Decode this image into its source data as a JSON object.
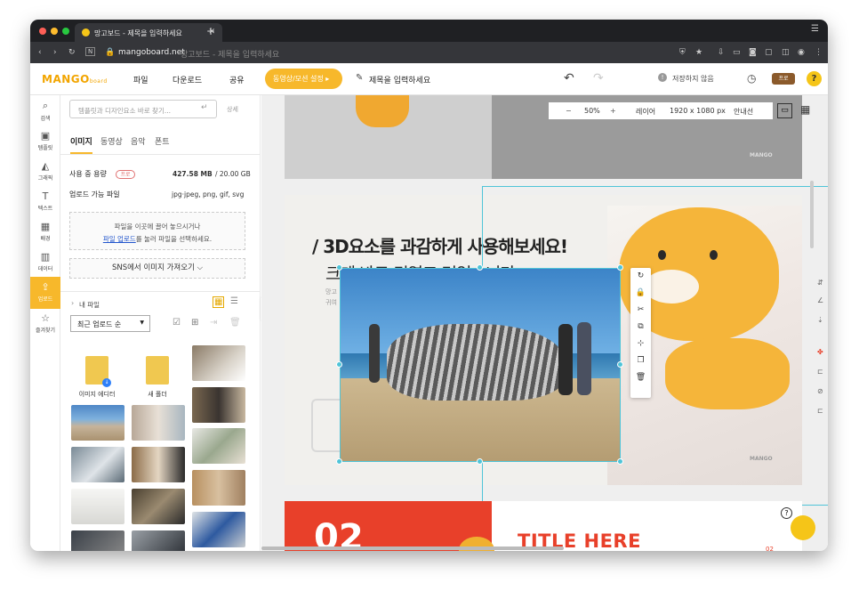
{
  "browser": {
    "tab_title": "망고보드 - 제목을 입력하세요",
    "url_domain": "mangoboard.net",
    "url_rest": "망고보드 - 제목을 입력하세요"
  },
  "app": {
    "logo": "MANGO",
    "logo_small": "board",
    "menu": [
      "파일",
      "다운로드",
      "공유"
    ],
    "motion_button": "동영상/모션 설정 ▸",
    "doc_title": "제목을 입력하세요",
    "save_status": "저장하지 않음",
    "pro_badge": "프로",
    "help": "?"
  },
  "iconbar": [
    {
      "icon": "⌕",
      "label": "검색",
      "name": "search-icon"
    },
    {
      "icon": "▣",
      "label": "템플릿",
      "name": "template-icon"
    },
    {
      "icon": "◭",
      "label": "그래픽",
      "name": "graphic-icon"
    },
    {
      "icon": "T",
      "label": "텍스트",
      "name": "text-icon"
    },
    {
      "icon": "▦",
      "label": "배경",
      "name": "background-icon"
    },
    {
      "icon": "▥",
      "label": "데이터",
      "name": "data-icon"
    },
    {
      "icon": "⇪",
      "label": "업로드",
      "name": "upload-icon"
    },
    {
      "icon": "☆",
      "label": "즐겨찾기",
      "name": "favorite-icon"
    }
  ],
  "panel": {
    "search_placeholder": "템플릿과 디자인요소 바로 찾기...",
    "detail": "상세",
    "tabs": [
      "이미지",
      "동영상",
      "음악",
      "폰트"
    ],
    "usage_label": "사용 중 용량",
    "usage_badge": "프로",
    "usage_value": "427.58 MB",
    "usage_total": "/ 20.00 GB",
    "types_label": "업로드 가능 파일",
    "types_value": "jpg·jpeg, png, gif, svg",
    "drop_line1": "파일을 이곳에 끌어 놓으시거나",
    "drop_link": "파일 업로드",
    "drop_line2": "를 눌러 파일을 선택하세요.",
    "sns_button": "SNS에서 이미지 가져오기 ⌵",
    "my_files": "내 파일",
    "sort": "최근 업로드 순",
    "folder1": "이미지 에디터",
    "folder2": "새 폴더"
  },
  "canvas": {
    "zoom": "50%",
    "layer": "레이어",
    "size": "1920 x 1080 px",
    "guide": "안내선",
    "headline": "/ 3D요소를 과감하게 사용해보세요!",
    "subline": "크게 봐도 귀엽고 멋있습니다.",
    "small_text": "망고",
    "small_text2": "귀여",
    "mango_mark": "MANGO",
    "number": "02",
    "title_here": "TITLE HERE",
    "page_num": "02",
    "context_icons": [
      "↻",
      "🔒",
      "✂",
      "⧉",
      "⊹",
      "❐",
      "🗑"
    ]
  },
  "colors": {
    "accent": "#f7b82b",
    "link": "#2255cc",
    "selection": "#4fc4d8",
    "red": "#e8402a"
  }
}
